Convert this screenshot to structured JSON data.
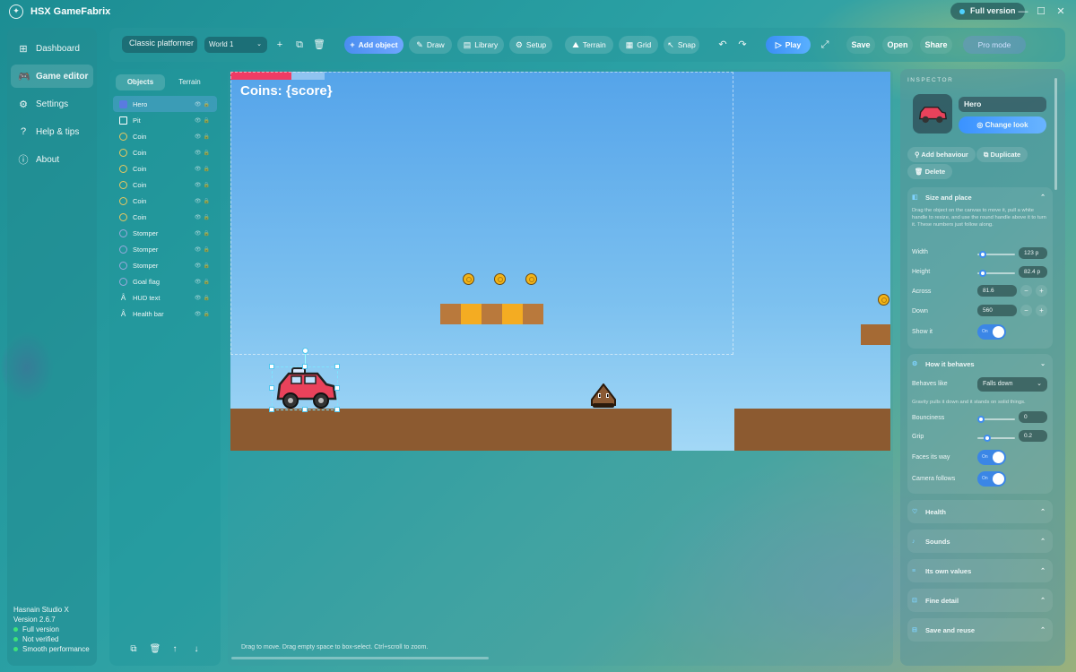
{
  "app": {
    "title": "HSX GameFabrix",
    "license": "Full version"
  },
  "nav": {
    "items": [
      {
        "label": "Dashboard",
        "icon": "dashboard-icon"
      },
      {
        "label": "Game editor",
        "icon": "gamepad-icon"
      },
      {
        "label": "Settings",
        "icon": "gear-icon"
      },
      {
        "label": "Help & tips",
        "icon": "question-icon"
      },
      {
        "label": "About",
        "icon": "info-icon"
      }
    ],
    "active": "Game editor"
  },
  "studio": {
    "name": "Hasnain Studio X",
    "version": "Version 2.6.7",
    "status": [
      "Full version",
      "Not verified",
      "Smooth performance"
    ]
  },
  "toolbar": {
    "project": "Classic platformer",
    "world": "World 1",
    "add_object": "Add object",
    "draw": "Draw",
    "library": "Library",
    "setup": "Setup",
    "terrain": "Terrain",
    "grid": "Grid",
    "snap": "Snap",
    "play": "Play",
    "save": "Save",
    "open": "Open",
    "share": "Share",
    "pro_mode": "Pro mode"
  },
  "objects": {
    "tabs": [
      "Objects",
      "Terrain"
    ],
    "items": [
      {
        "label": "Hero",
        "icon": "hero-icon",
        "selected": true
      },
      {
        "label": "Pit",
        "icon": "square-icon"
      },
      {
        "label": "Coin",
        "icon": "coin-icon"
      },
      {
        "label": "Coin",
        "icon": "coin-icon"
      },
      {
        "label": "Coin",
        "icon": "coin-icon"
      },
      {
        "label": "Coin",
        "icon": "coin-icon"
      },
      {
        "label": "Coin",
        "icon": "coin-icon"
      },
      {
        "label": "Coin",
        "icon": "coin-icon"
      },
      {
        "label": "Stomper",
        "icon": "stomper-icon"
      },
      {
        "label": "Stomper",
        "icon": "stomper-icon"
      },
      {
        "label": "Stomper",
        "icon": "stomper-icon"
      },
      {
        "label": "Goal flag",
        "icon": "flag-icon"
      },
      {
        "label": "HUD text",
        "icon": "text-icon"
      },
      {
        "label": "Health bar",
        "icon": "text-icon"
      }
    ]
  },
  "canvas": {
    "score_text": "Coins: {score}",
    "hint": "Drag to move. Drag empty space to box-select. Ctrl+scroll to zoom.",
    "health_fraction": 0.65
  },
  "inspector": {
    "header": "INSPECTOR",
    "name": "Hero",
    "change_look": "Change look",
    "add_behaviour": "Add behaviour",
    "duplicate": "Duplicate",
    "delete": "Delete",
    "size_place": {
      "title": "Size and place",
      "desc": "Drag the object on the canvas to move it, pull a white handle to resize, and use the round handle above it to turn it. These numbers just follow along.",
      "width_label": "Width",
      "width": "123 p",
      "width_level": 0.06,
      "height_label": "Height",
      "height": "82.4 p",
      "height_level": 0.06,
      "across_label": "Across",
      "across": "81.6",
      "down_label": "Down",
      "down": "560",
      "show_label": "Show it",
      "show": "On"
    },
    "behaves": {
      "title": "How it behaves",
      "like_label": "Behaves like",
      "like": "Falls down",
      "desc": "Gravity pulls it down and it stands on solid things.",
      "bounciness_label": "Bounciness",
      "bounciness": "0",
      "bounciness_level": 0,
      "grip_label": "Grip",
      "grip": "0.2",
      "grip_level": 0.2,
      "faces_label": "Faces its way",
      "faces": "On",
      "camera_label": "Camera follows",
      "camera": "On"
    },
    "collapsed": [
      "Health",
      "Sounds",
      "Its own values",
      "Fine detail",
      "Save and reuse"
    ]
  },
  "colors": {
    "accent": "#3b8ef0",
    "health": "#ef3c64",
    "ground": "#8c5a30",
    "coin": "#f3b417"
  }
}
